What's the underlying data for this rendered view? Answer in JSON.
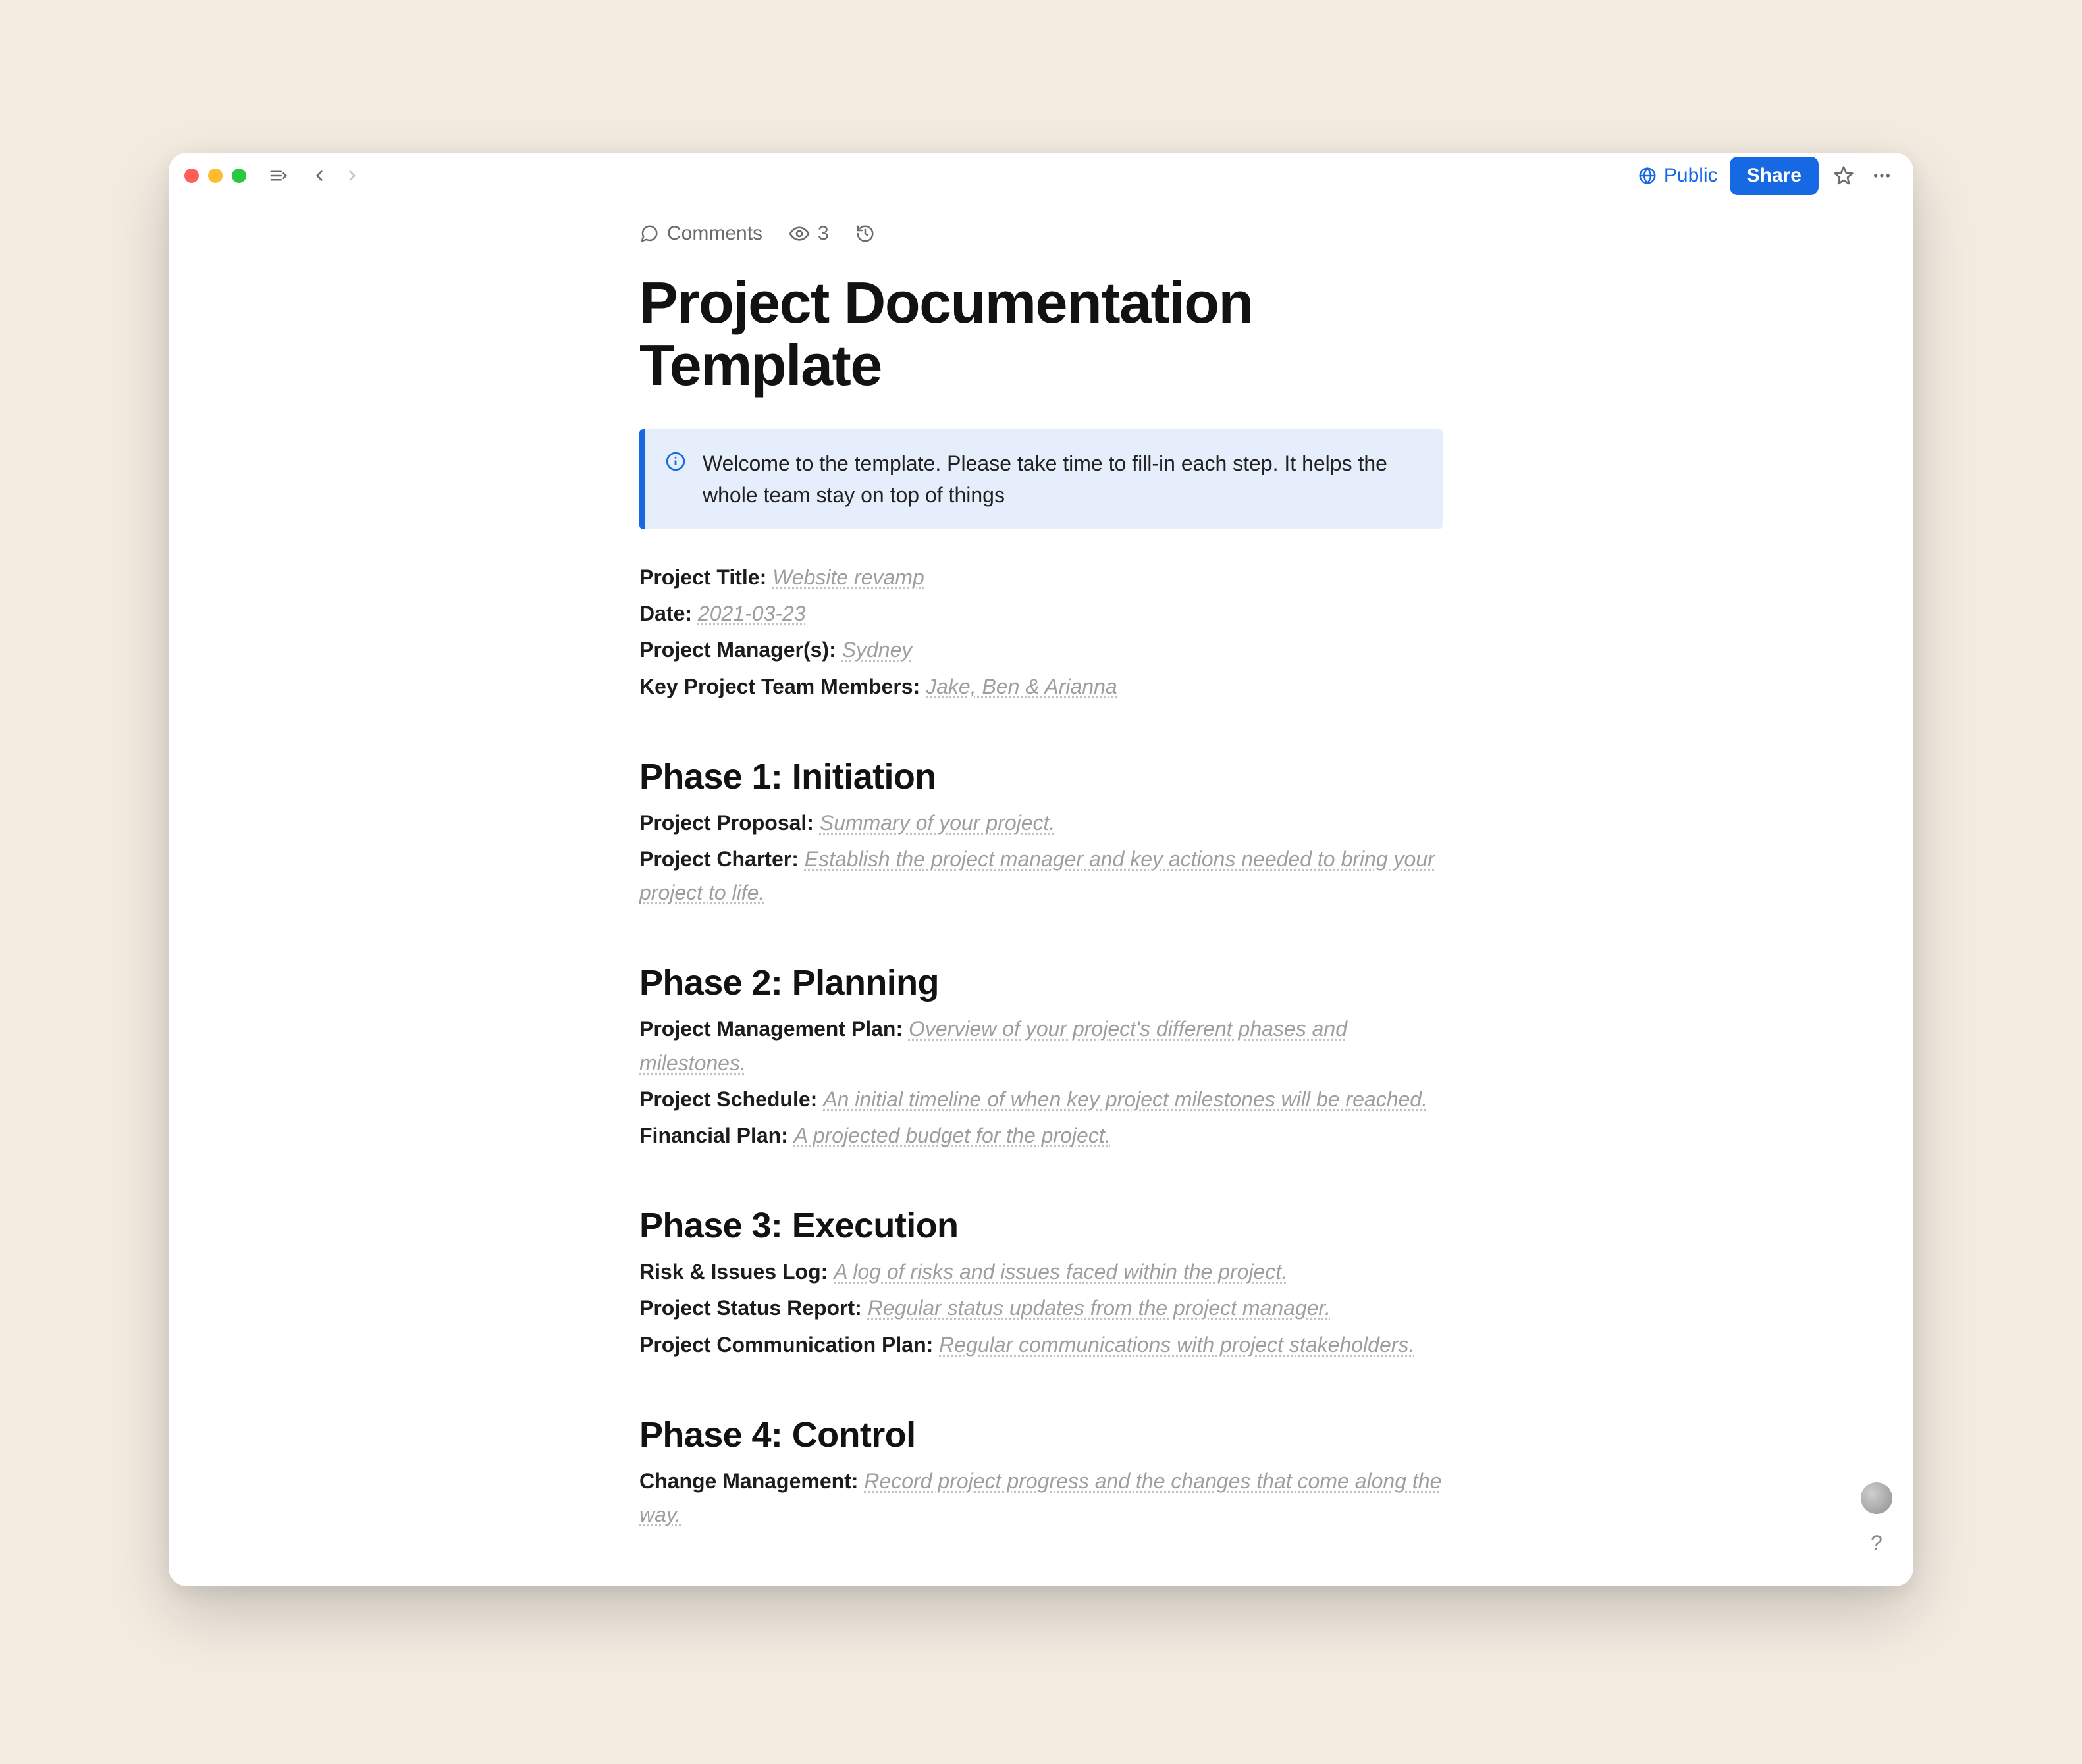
{
  "toolbar": {
    "public_label": "Public",
    "share_label": "Share"
  },
  "meta": {
    "comments_label": "Comments",
    "views_count": "3"
  },
  "document": {
    "title": "Project Documentation Template",
    "callout": "Welcome to the template. Please take time to fill-in each step. It helps the whole team stay on top of things",
    "header_fields": {
      "project_title": {
        "label": "Project Title:",
        "value": "Website revamp"
      },
      "date": {
        "label": "Date:",
        "value": "2021-03-23 "
      },
      "managers": {
        "label": "Project Manager(s):",
        "value": "Sydney"
      },
      "members": {
        "label": "Key Project Team Members:",
        "value": "Jake, Ben & Arianna"
      }
    },
    "phases": [
      {
        "heading": "Phase 1: Initiation",
        "items": [
          {
            "label": "Project Proposal:",
            "value": "Summary of your project."
          },
          {
            "label": "Project Charter:",
            "value": "Establish the project manager and key actions needed to bring your project to life. "
          }
        ]
      },
      {
        "heading": "Phase 2: Planning",
        "items": [
          {
            "label": "Project Management Plan:",
            "value": "Overview of your project's different phases and milestones."
          },
          {
            "label": "Project Schedule:",
            "value": "An initial timeline of when key project milestones will be reached."
          },
          {
            "label": "Financial Plan:",
            "value": "A projected budget for the project. "
          }
        ]
      },
      {
        "heading": "Phase 3: Execution",
        "items": [
          {
            "label": "Risk & Issues Log:",
            "value": "A log of risks and issues faced within the project."
          },
          {
            "label": "Project Status Report:",
            "value": "Regular status updates from the project manager."
          },
          {
            "label": "Project Communication Plan:",
            "value": "Regular communications with project stakeholders."
          }
        ]
      },
      {
        "heading": "Phase 4: Control",
        "items": [
          {
            "label": "Change Management:",
            "value": "Record project progress and the changes that come along the way."
          }
        ]
      }
    ]
  },
  "help_glyph": "?"
}
